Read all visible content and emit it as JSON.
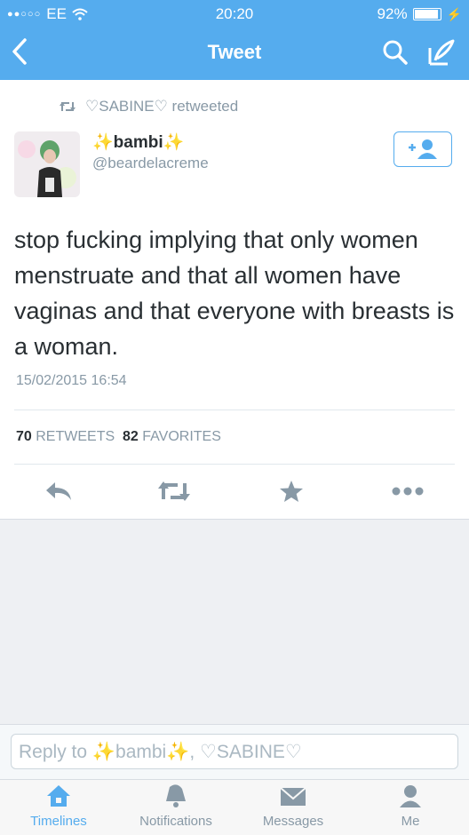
{
  "status_bar": {
    "carrier": "EE",
    "time": "20:20",
    "battery": "92%"
  },
  "nav": {
    "title": "Tweet"
  },
  "retweet": {
    "text": "♡SABINE♡ retweeted"
  },
  "tweet": {
    "name": "bambi",
    "handle": "@beardelacreme",
    "text": "stop fucking implying that only women menstruate and that all women have vaginas and that everyone with breasts is a woman.",
    "timestamp": "15/02/2015 16:54",
    "retweets_count": "70",
    "retweets_label": "RETWEETS",
    "favorites_count": "82",
    "favorites_label": "FAVORITES"
  },
  "reply": {
    "placeholder_prefix": "Reply to ",
    "placeholder_name": "bambi",
    "placeholder_rest": ", ♡SABINE♡"
  },
  "tabbar": {
    "items": [
      {
        "label": "Timelines",
        "icon": "home-icon"
      },
      {
        "label": "Notifications",
        "icon": "bell-icon"
      },
      {
        "label": "Messages",
        "icon": "envelope-icon"
      },
      {
        "label": "Me",
        "icon": "person-icon"
      }
    ]
  },
  "colors": {
    "brand": "#55acee",
    "text": "#292f33",
    "muted": "#8899a6"
  }
}
